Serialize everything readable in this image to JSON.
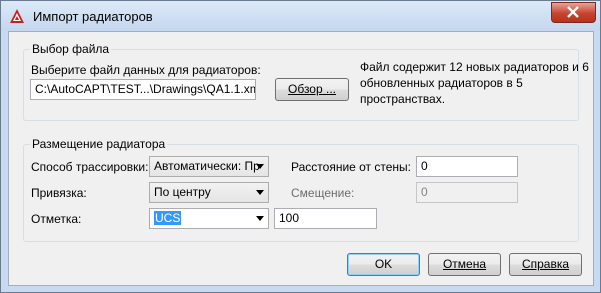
{
  "window": {
    "title": "Импорт радиаторов"
  },
  "file_group": {
    "title": "Выбор файла",
    "select_label": "Выберите файл данных для радиаторов:",
    "path_value": "C:\\AutoCAPT\\TEST...\\Drawings\\QA1.1.xml",
    "browse_label": "Обзор ...",
    "description": "Файл содержит 12 новых радиаторов и 6 обновленных радиаторов в 5 пространствах."
  },
  "placement_group": {
    "title": "Размещение радиатора",
    "routing_label": "Способ трассировки:",
    "routing_value": "Автоматически: Пр",
    "snap_label": "Привязка:",
    "snap_value": "По центру",
    "elevation_label": "Отметка:",
    "elevation_ref_value": "UCS",
    "elevation_value": "100",
    "wall_distance_label": "Расстояние от стены:",
    "wall_distance_value": "0",
    "offset_label": "Смещение:",
    "offset_value": "0"
  },
  "buttons": {
    "ok": "OK",
    "cancel": "Отмена",
    "help": "Справка"
  },
  "colors": {
    "titlebar": "#c9daf0",
    "close_button": "#c7442f",
    "selection": "#3399ff",
    "dialog_bg": "#f0f0f0"
  }
}
